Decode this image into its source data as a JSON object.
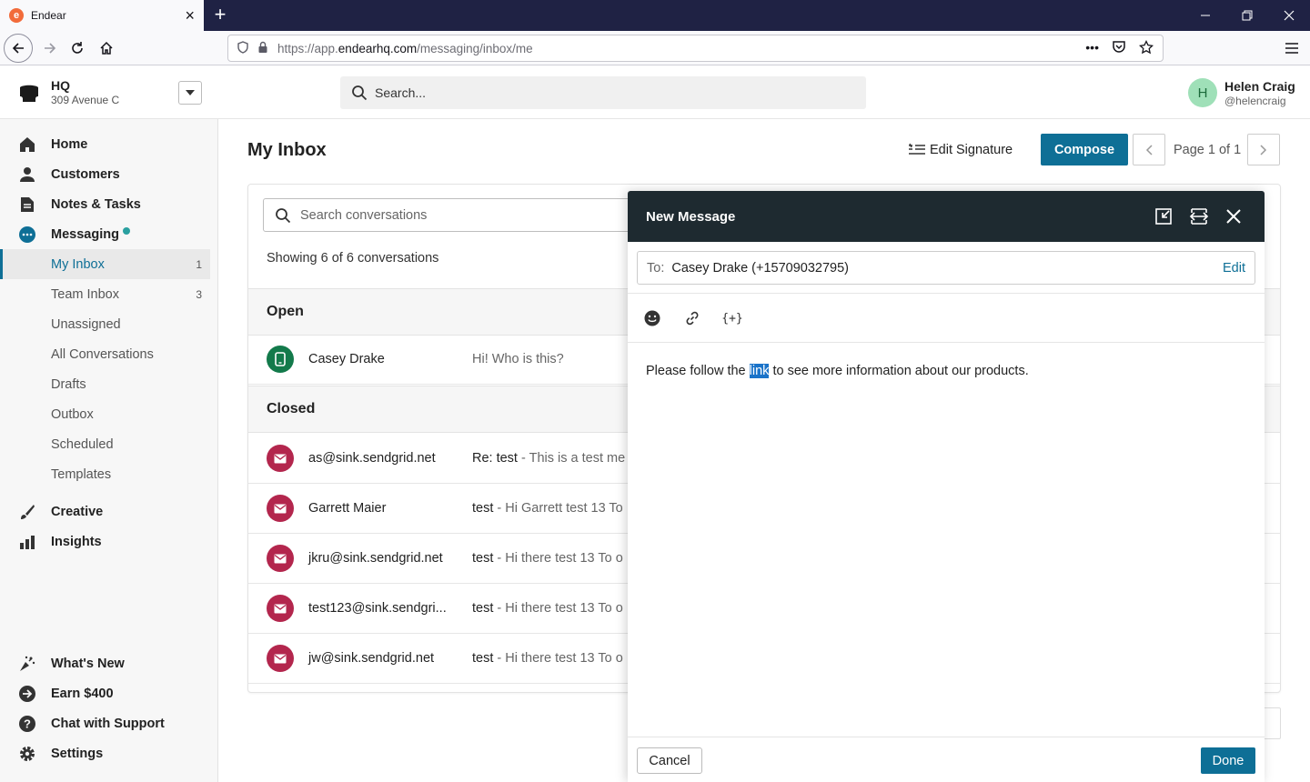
{
  "browser": {
    "tab_title": "Endear",
    "favicon_letter": "e",
    "url_prefix": "https://app.",
    "url_domain": "endearhq.com",
    "url_path": "/messaging/inbox/me"
  },
  "header": {
    "org_name": "HQ",
    "org_address": "309 Avenue C",
    "search_placeholder": "Search...",
    "user_initial": "H",
    "user_name": "Helen Craig",
    "user_handle": "@helencraig"
  },
  "sidebar": {
    "nav": [
      {
        "label": "Home",
        "icon": "home-icon"
      },
      {
        "label": "Customers",
        "icon": "person-icon"
      },
      {
        "label": "Notes & Tasks",
        "icon": "note-icon"
      },
      {
        "label": "Messaging",
        "icon": "chat-icon"
      }
    ],
    "messaging_items": [
      {
        "label": "My Inbox",
        "count": "1"
      },
      {
        "label": "Team Inbox",
        "count": "3"
      },
      {
        "label": "Unassigned",
        "count": ""
      },
      {
        "label": "All Conversations",
        "count": ""
      },
      {
        "label": "Drafts",
        "count": ""
      },
      {
        "label": "Outbox",
        "count": ""
      },
      {
        "label": "Scheduled",
        "count": ""
      },
      {
        "label": "Templates",
        "count": ""
      }
    ],
    "nav2": [
      {
        "label": "Creative",
        "icon": "brush-icon"
      },
      {
        "label": "Insights",
        "icon": "bar-chart-icon"
      }
    ],
    "bottom": [
      {
        "label": "What's New",
        "icon": "sparkle-icon"
      },
      {
        "label": "Earn $400",
        "icon": "arrow-circle-icon"
      },
      {
        "label": "Chat with Support",
        "icon": "help-icon"
      },
      {
        "label": "Settings",
        "icon": "gear-icon"
      }
    ]
  },
  "main": {
    "title": "My Inbox",
    "edit_signature": "Edit Signature",
    "compose": "Compose",
    "page_label": "Page 1 of 1",
    "conv_search_placeholder": "Search conversations",
    "showing": "Showing 6 of 6 conversations",
    "open_label": "Open",
    "closed_label": "Closed",
    "open_rows": [
      {
        "name": "Casey Drake",
        "subject": "",
        "preview": "Hi! Who is this?",
        "type": "phone"
      }
    ],
    "closed_rows": [
      {
        "name": "as@sink.sendgrid.net",
        "subject": "Re: test",
        "preview": "This is a test me",
        "type": "email"
      },
      {
        "name": "Garrett Maier",
        "subject": "test",
        "preview": "Hi Garrett test 13 To",
        "type": "email"
      },
      {
        "name": "jkru@sink.sendgrid.net",
        "subject": "test",
        "preview": "Hi there test 13 To o",
        "type": "email"
      },
      {
        "name": "test123@sink.sendgri...",
        "subject": "test",
        "preview": "Hi there test 13 To o",
        "type": "email"
      },
      {
        "name": "jw@sink.sendgrid.net",
        "subject": "test",
        "preview": "Hi there test 13 To o",
        "type": "email"
      }
    ]
  },
  "modal": {
    "title": "New Message",
    "to_label": "To:",
    "to_value": "Casey Drake (+15709032795)",
    "edit_label": "Edit",
    "variable_label": "{+}",
    "body_before": "Please follow the ",
    "body_selected": "link",
    "body_after": " to see more information about our products.",
    "cancel": "Cancel",
    "done": "Done"
  },
  "colors": {
    "primary": "#0e6f96",
    "email_avatar": "#b3264d",
    "phone_avatar": "#137a4b",
    "modal_header": "#1e2a30",
    "tabbar": "#1f2244"
  }
}
